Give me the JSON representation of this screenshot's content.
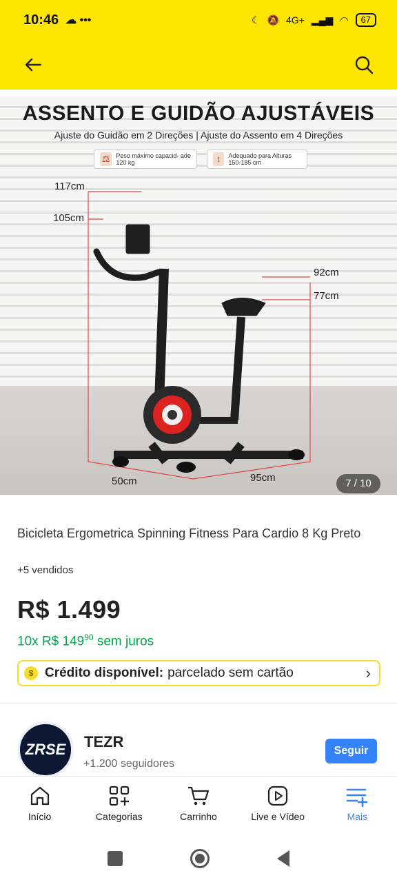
{
  "status_bar": {
    "time": "10:46",
    "battery": "67",
    "network": "4G+"
  },
  "header": {
    "back_icon": "arrow-left-icon",
    "search_icon": "search-icon"
  },
  "gallery": {
    "title": "ASSENTO E GUIDÃO AJUSTÁVEIS",
    "subtitle": "Ajuste do Guidão em 2 Direções | Ajuste do Assento em 4 Direções",
    "badge_weight": "Peso máximo capacid- ade 120 kg",
    "badge_height": "Adequado para Alturas 150-185 cm",
    "dims": {
      "d117": "117cm",
      "d105": "105cm",
      "d92": "92cm",
      "d77": "77cm",
      "d50": "50cm",
      "d95": "95cm"
    },
    "counter": "7 / 10"
  },
  "product": {
    "title": "Bicicleta Ergometrica Spinning Fitness Para Cardio 8 Kg Preto",
    "sold": "+5 vendidos",
    "price": "R$ 1.499",
    "installments_prefix": "10x R$ 149",
    "installments_cents": "90",
    "installments_suffix": "sem juros",
    "credit_bold": "Crédito disponível:",
    "credit_text": "parcelado sem cartão"
  },
  "seller": {
    "logo_text": "ZRSE",
    "name": "TEZR",
    "followers": "+1.200 seguidores",
    "follow_label": "Seguir"
  },
  "bottom_nav": {
    "items": [
      {
        "label": "Início",
        "icon": "home-icon"
      },
      {
        "label": "Categorias",
        "icon": "categories-icon"
      },
      {
        "label": "Carrinho",
        "icon": "cart-icon"
      },
      {
        "label": "Live e Vídeo",
        "icon": "play-icon"
      },
      {
        "label": "Mais",
        "icon": "menu-plus-icon"
      }
    ],
    "active_color": "#3483fa"
  },
  "colors": {
    "header": "#FFE600",
    "accent": "#3483fa",
    "green": "#00a650"
  }
}
